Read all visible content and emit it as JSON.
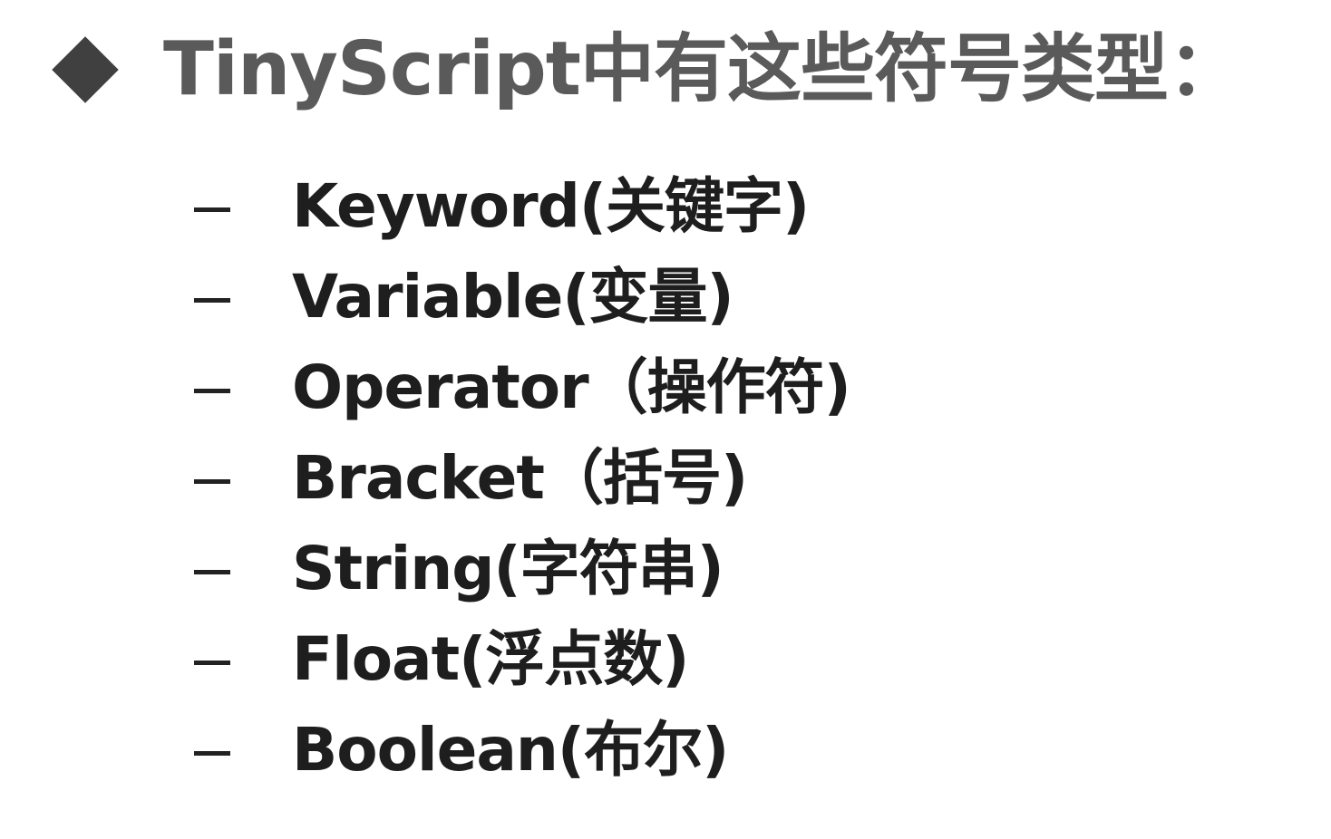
{
  "heading": {
    "text": "TinyScript中有这些符号类型："
  },
  "items": [
    {
      "label": "Keyword(关键字)"
    },
    {
      "label": "Variable(变量)"
    },
    {
      "label": "Operator（操作符)"
    },
    {
      "label": "Bracket（括号)"
    },
    {
      "label": "String(字符串)"
    },
    {
      "label": "Float(浮点数)"
    },
    {
      "label": "Boolean(布尔)"
    }
  ],
  "colors": {
    "heading": "#5a5a5a",
    "bullet": "#404040",
    "item_text": "#1e1e1e"
  }
}
